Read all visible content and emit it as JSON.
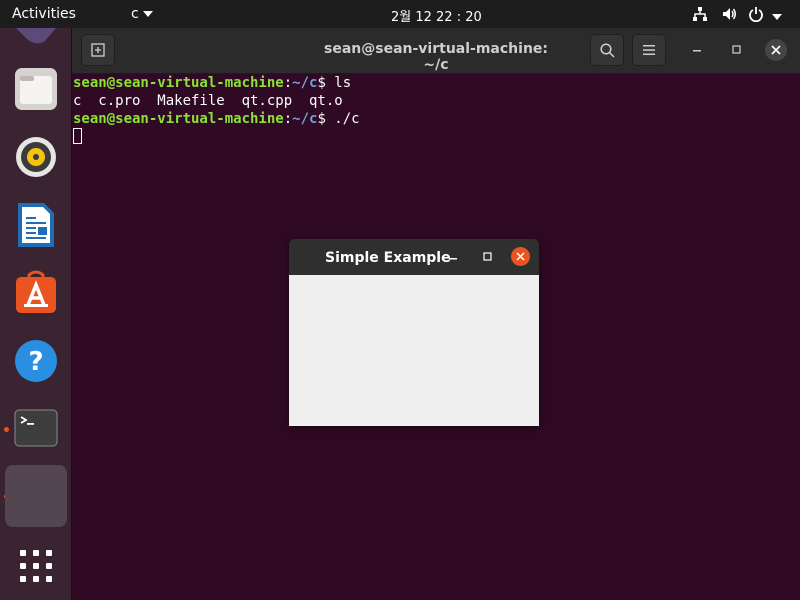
{
  "topbar": {
    "activities": "Activities",
    "app_menu": "c",
    "clock": "2월 12  22 : 20",
    "icons": [
      "network-icon",
      "volume-icon",
      "power-icon",
      "chevron-down-icon"
    ]
  },
  "dock": {
    "items": [
      {
        "name": "files",
        "icon": "folder-icon"
      },
      {
        "name": "rhythmbox",
        "icon": "speaker-icon"
      },
      {
        "name": "writer",
        "icon": "document-icon"
      },
      {
        "name": "software",
        "icon": "app-store-icon"
      },
      {
        "name": "help",
        "icon": "help-icon"
      },
      {
        "name": "terminal",
        "icon": "terminal-icon",
        "running": true
      },
      {
        "name": "simple-example",
        "icon": "blank-app-icon",
        "running": true,
        "active": true
      }
    ],
    "app_grid_icon": "grid-icon"
  },
  "terminal": {
    "title": "sean@sean-virtual-machine: ~/c",
    "lines": [
      {
        "user": "sean@sean-virtual-machine",
        "sep": ":",
        "path": "~/c",
        "cmd": "$ ls"
      },
      {
        "output": "c  c.pro  Makefile  qt.cpp  qt.o"
      },
      {
        "user": "sean@sean-virtual-machine",
        "sep": ":",
        "path": "~/c",
        "cmd": "$ ./c"
      }
    ]
  },
  "dialog": {
    "title": "Simple Example"
  },
  "colors": {
    "desktop": "#2c001e",
    "terminal_bg": "#300a24",
    "prompt_user": "#8ae234",
    "prompt_path": "#729fcf",
    "accent": "#e95420"
  }
}
